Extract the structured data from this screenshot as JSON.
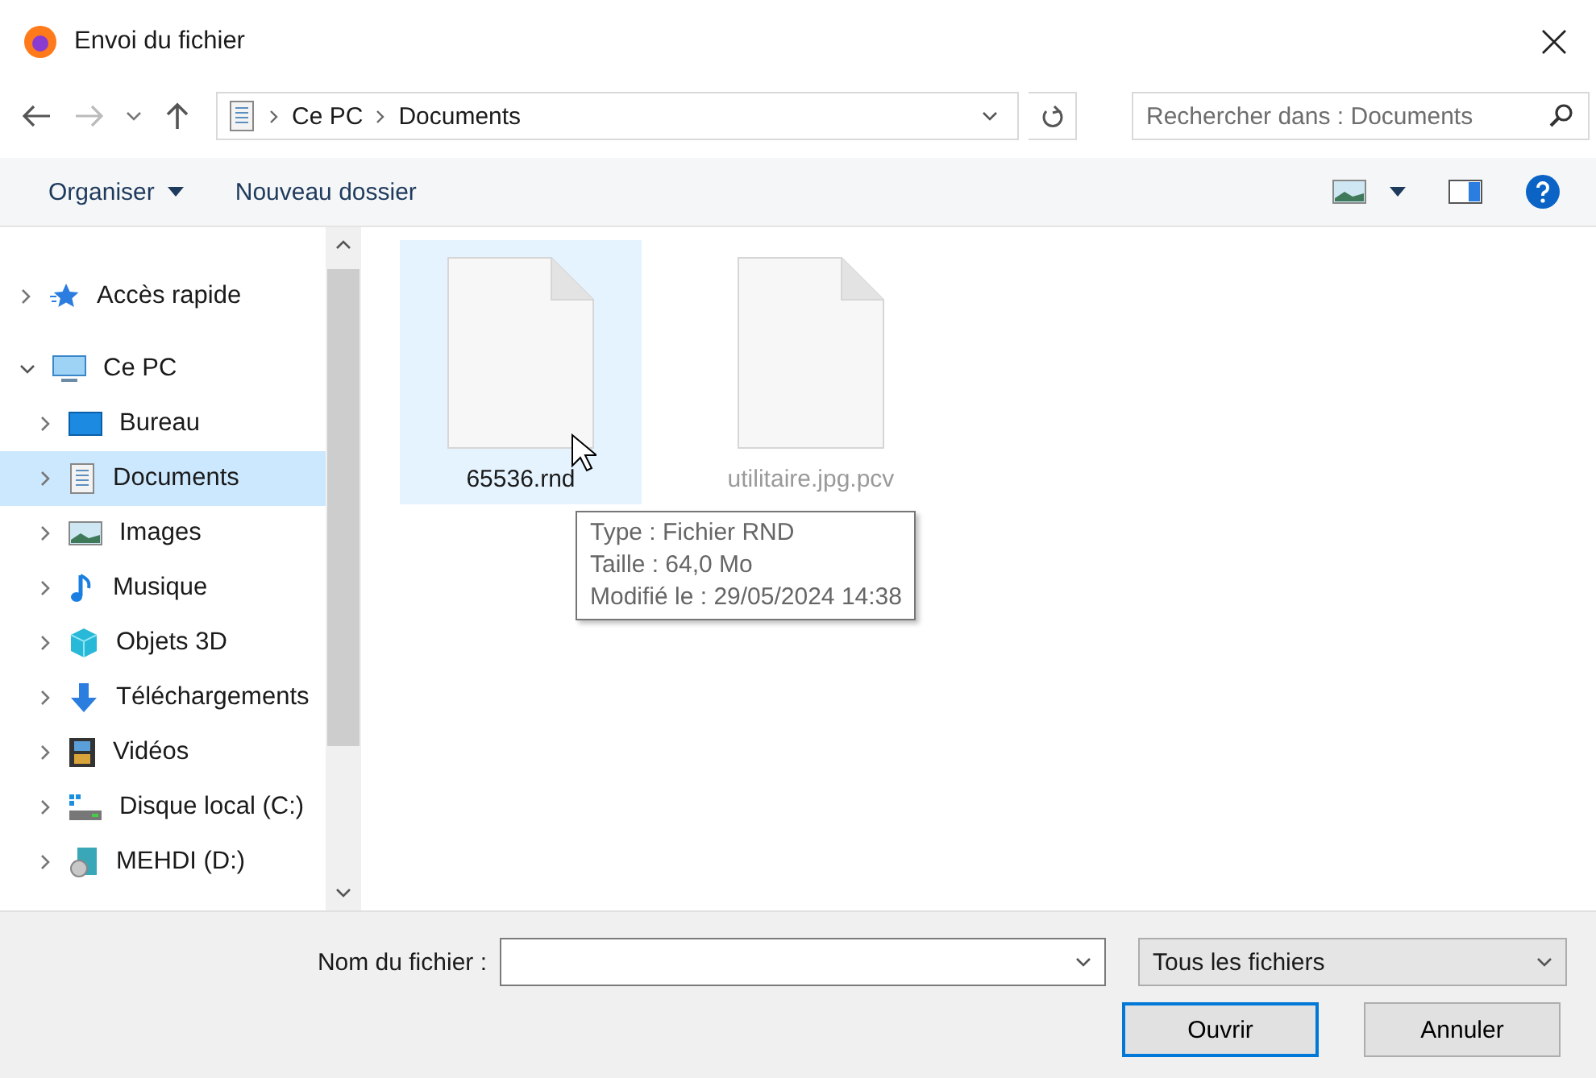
{
  "window": {
    "title": "Envoi du fichier"
  },
  "address": {
    "path": [
      {
        "label": "Ce PC"
      },
      {
        "label": "Documents"
      }
    ]
  },
  "search": {
    "placeholder": "Rechercher dans : Documents"
  },
  "toolbar": {
    "organize": "Organiser",
    "new_folder": "Nouveau dossier"
  },
  "sidebar": {
    "items": [
      {
        "label": "Accès rapide",
        "kind": "star",
        "expanded": false,
        "selected": false
      },
      {
        "label": "Ce PC",
        "kind": "pc",
        "expanded": true,
        "selected": false,
        "children": [
          {
            "label": "Bureau",
            "kind": "desktop",
            "expanded": false,
            "selected": false
          },
          {
            "label": "Documents",
            "kind": "documents",
            "expanded": false,
            "selected": true
          },
          {
            "label": "Images",
            "kind": "images",
            "expanded": false,
            "selected": false
          },
          {
            "label": "Musique",
            "kind": "music",
            "expanded": false,
            "selected": false
          },
          {
            "label": "Objets 3D",
            "kind": "objects3d",
            "expanded": false,
            "selected": false
          },
          {
            "label": "Téléchargements",
            "kind": "downloads",
            "expanded": false,
            "selected": false
          },
          {
            "label": "Vidéos",
            "kind": "videos",
            "expanded": false,
            "selected": false
          },
          {
            "label": "Disque local (C:)",
            "kind": "disk",
            "expanded": false,
            "selected": false
          },
          {
            "label": "MEHDI (D:)",
            "kind": "drive",
            "expanded": false,
            "selected": false
          }
        ]
      }
    ]
  },
  "files": [
    {
      "name": "65536.rnd",
      "selected": true
    },
    {
      "name": "utilitaire.jpg.pcv",
      "selected": false
    }
  ],
  "tooltip": {
    "lines": [
      "Type : Fichier RND",
      "Taille : 64,0 Mo",
      "Modifié le : 29/05/2024 14:38"
    ]
  },
  "footer": {
    "filename_label": "Nom du fichier :",
    "filter": "Tous les fichiers",
    "buttons": [
      {
        "label": "Ouvrir",
        "kind": "default"
      },
      {
        "label": "Annuler",
        "kind": "normal"
      }
    ]
  }
}
